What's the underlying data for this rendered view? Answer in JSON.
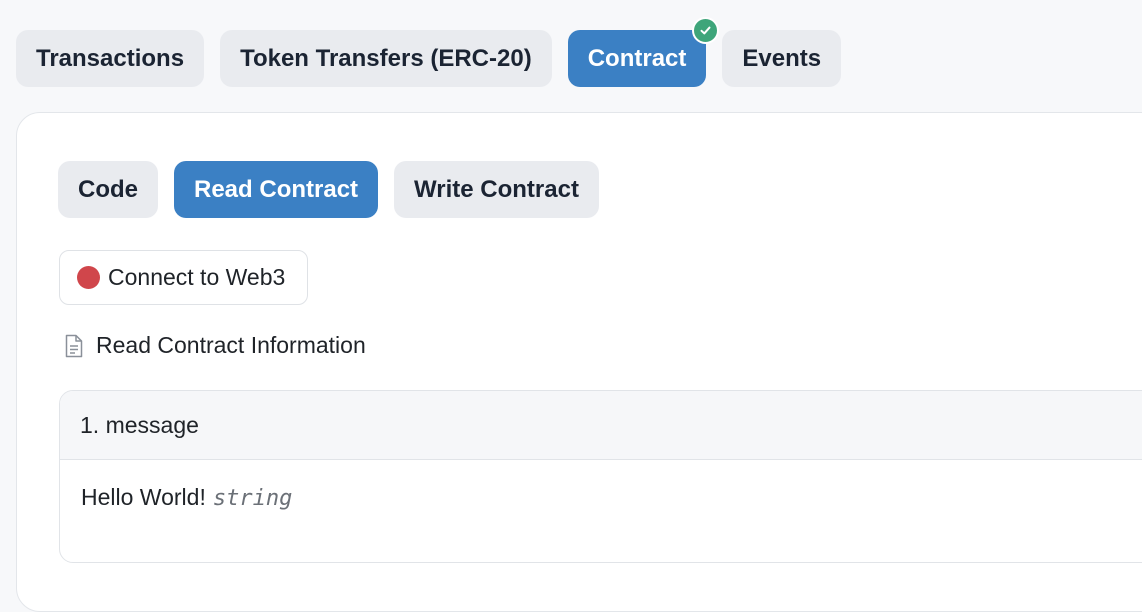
{
  "top_tabs": [
    {
      "label": "Transactions",
      "active": false
    },
    {
      "label": "Token Transfers (ERC-20)",
      "active": false
    },
    {
      "label": "Contract",
      "active": true,
      "verified": true
    },
    {
      "label": "Events",
      "active": false
    }
  ],
  "sub_tabs": [
    {
      "label": "Code",
      "active": false
    },
    {
      "label": "Read Contract",
      "active": true
    },
    {
      "label": "Write Contract",
      "active": false
    }
  ],
  "connect_button": {
    "label": "Connect to Web3",
    "status_color": "#d0464b"
  },
  "section_heading": "Read Contract Information",
  "methods": [
    {
      "title": "1. message",
      "value": "Hello World!",
      "type": "string"
    }
  ],
  "colors": {
    "accent": "#3b80c4",
    "verified_badge": "#3ea57a",
    "disconnected": "#d0464b"
  },
  "icons": {
    "verified": "check-icon",
    "section": "document-icon"
  }
}
